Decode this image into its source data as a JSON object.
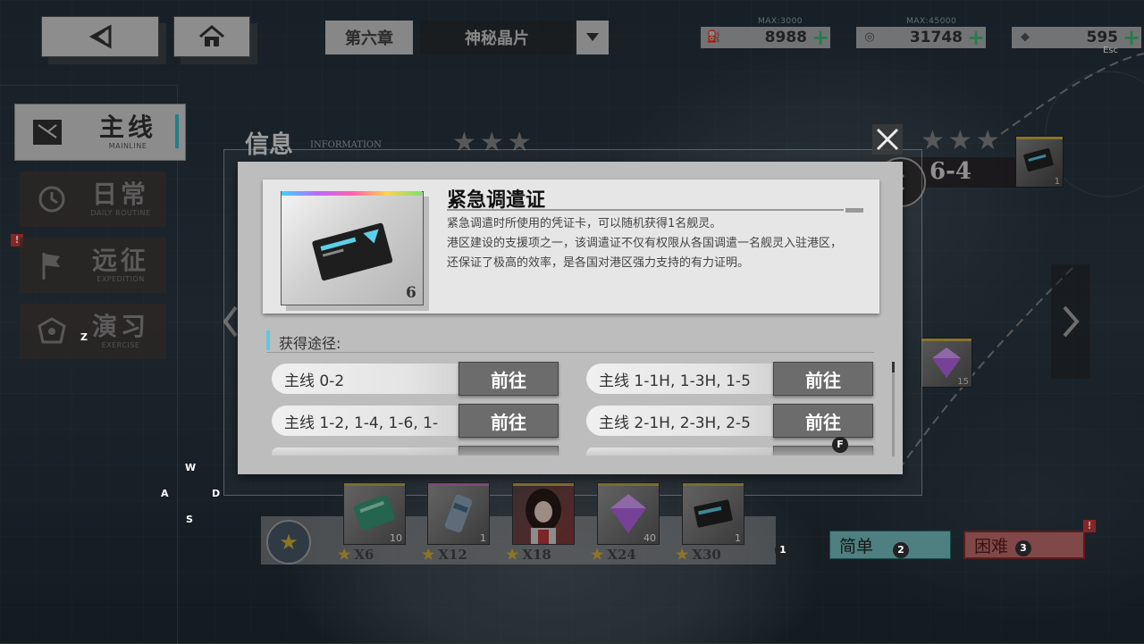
{
  "topbar": {
    "chapter": "第六章",
    "chapter_name": "神秘晶片",
    "resources": [
      {
        "max": "MAX:3000",
        "value": "8988",
        "icon": "oil-icon"
      },
      {
        "max": "MAX:45000",
        "value": "31748",
        "icon": "coin-icon"
      },
      {
        "max": "",
        "value": "595",
        "icon": "diamond-icon"
      }
    ],
    "esc_hint": "Esc"
  },
  "sidebar": {
    "items": [
      {
        "cn": "主线",
        "en": "MAINLINE"
      },
      {
        "cn": "日常",
        "en": "DAILY ROUTINE"
      },
      {
        "cn": "远征",
        "en": "EXPEDITION"
      },
      {
        "cn": "演习",
        "en": "EXERCISE"
      }
    ],
    "alert": "!"
  },
  "keys": {
    "z": "Z",
    "w": "W",
    "a": "A",
    "s": "S",
    "d": "D",
    "f": "F",
    "one": "1",
    "two": "2",
    "three": "3"
  },
  "info": {
    "title": "信息",
    "subtitle": "INFORMATION"
  },
  "modal": {
    "item_name": "紧急调遣证",
    "item_count": "6",
    "description": [
      "紧急调遣时所使用的凭证卡，可以随机获得1名舰灵。",
      "港区建设的支援项之一，该调遣证不仅有权限从各国调遣一名舰灵入驻港区，还保证了极高的效率，是各国对港区强力支持的有力证明。"
    ],
    "sources_label": "获得途径:",
    "routes": [
      {
        "text": "主线 0-2",
        "button": "前往"
      },
      {
        "text": "主线 1-1H, 1-3H, 1-5",
        "button": "前往"
      },
      {
        "text": "主线 1-2, 1-4, 1-6, 1-",
        "button": "前往"
      },
      {
        "text": "主线 2-1H, 2-3H, 2-5",
        "button": "前往"
      }
    ]
  },
  "stage": {
    "label": "6-4",
    "reward_count": "15",
    "card_count": "1"
  },
  "rewards": [
    {
      "count": "10",
      "stars": "X6"
    },
    {
      "count": "1",
      "stars": "X12"
    },
    {
      "count": "",
      "stars": "X18"
    },
    {
      "count": "40",
      "stars": "X24"
    },
    {
      "count": "1",
      "stars": "X30"
    }
  ],
  "difficulty": {
    "easy": "简单",
    "hard": "困难",
    "hard_alert": "!"
  },
  "colors": {
    "accent_cyan": "#33c4d8",
    "plus_green": "#3bbf7a",
    "easy": "#79c3c6",
    "hard": "#c56f6f",
    "alert_red": "#d23b3b"
  }
}
